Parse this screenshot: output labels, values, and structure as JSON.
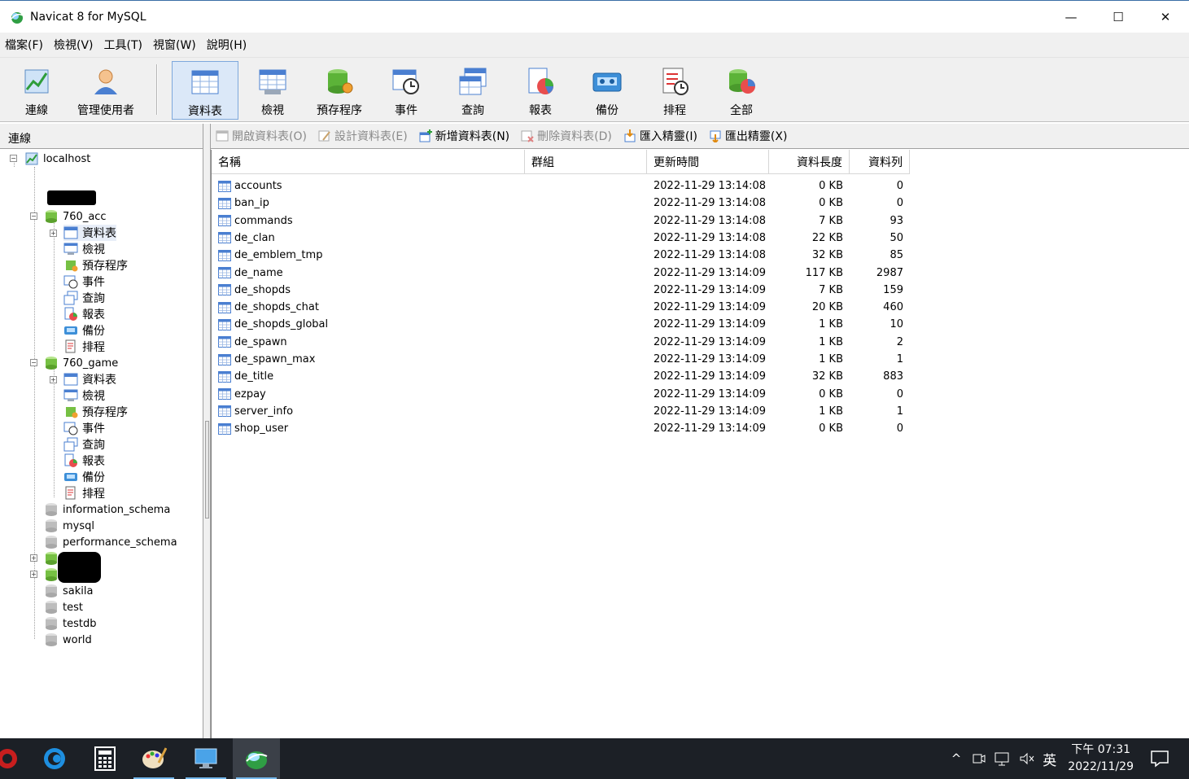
{
  "window": {
    "title": "Navicat 8 for MySQL",
    "minimize": "—",
    "maximize": "☐",
    "close": "✕"
  },
  "menu": [
    "檔案(F)",
    "檢視(V)",
    "工具(T)",
    "視窗(W)",
    "說明(H)"
  ],
  "toolbar": {
    "buttons": [
      {
        "label": "連線",
        "icon": "connection-icon"
      },
      {
        "label": "管理使用者",
        "icon": "user-manager-icon"
      },
      {
        "label": "資料表",
        "icon": "table-icon",
        "active": true
      },
      {
        "label": "檢視",
        "icon": "view-icon"
      },
      {
        "label": "預存程序",
        "icon": "procedure-icon"
      },
      {
        "label": "事件",
        "icon": "event-icon"
      },
      {
        "label": "查詢",
        "icon": "query-icon"
      },
      {
        "label": "報表",
        "icon": "report-icon"
      },
      {
        "label": "備份",
        "icon": "backup-icon"
      },
      {
        "label": "排程",
        "icon": "schedule-icon"
      },
      {
        "label": "全部",
        "icon": "all-icon"
      }
    ]
  },
  "left_panel": {
    "header": "連線",
    "tree": {
      "root": "localhost",
      "db1": "760_acc",
      "db2": "760_game",
      "child_labels": [
        "資料表",
        "檢視",
        "預存程序",
        "事件",
        "查詢",
        "報表",
        "備份",
        "排程"
      ],
      "other_dbs_top": [
        "information_schema",
        "mysql",
        "performance_schema"
      ],
      "other_dbs_bottom": [
        "sakila",
        "test",
        "testdb",
        "world"
      ]
    }
  },
  "object_toolbar": [
    {
      "label": "開啟資料表(O)",
      "enabled": false
    },
    {
      "label": "設計資料表(E)",
      "enabled": false
    },
    {
      "label": "新增資料表(N)",
      "enabled": true
    },
    {
      "label": "刪除資料表(D)",
      "enabled": false
    },
    {
      "label": "匯入精靈(I)",
      "enabled": true
    },
    {
      "label": "匯出精靈(X)",
      "enabled": true
    }
  ],
  "table": {
    "columns": [
      "名稱",
      "群組",
      "更新時間",
      "資料長度",
      "資料列"
    ],
    "rows": [
      {
        "name": "accounts",
        "group": "",
        "updated": "2022-11-29 13:14:08",
        "size": "0 KB",
        "rows": "0"
      },
      {
        "name": "ban_ip",
        "group": "",
        "updated": "2022-11-29 13:14:08",
        "size": "0 KB",
        "rows": "0"
      },
      {
        "name": "commands",
        "group": "",
        "updated": "2022-11-29 13:14:08",
        "size": "7 KB",
        "rows": "93"
      },
      {
        "name": "de_clan",
        "group": "",
        "updated": "2022-11-29 13:14:08",
        "size": "22 KB",
        "rows": "50"
      },
      {
        "name": "de_emblem_tmp",
        "group": "",
        "updated": "2022-11-29 13:14:08",
        "size": "32 KB",
        "rows": "85"
      },
      {
        "name": "de_name",
        "group": "",
        "updated": "2022-11-29 13:14:09",
        "size": "117 KB",
        "rows": "2987"
      },
      {
        "name": "de_shopds",
        "group": "",
        "updated": "2022-11-29 13:14:09",
        "size": "7 KB",
        "rows": "159"
      },
      {
        "name": "de_shopds_chat",
        "group": "",
        "updated": "2022-11-29 13:14:09",
        "size": "20 KB",
        "rows": "460"
      },
      {
        "name": "de_shopds_global",
        "group": "",
        "updated": "2022-11-29 13:14:09",
        "size": "1 KB",
        "rows": "10"
      },
      {
        "name": "de_spawn",
        "group": "",
        "updated": "2022-11-29 13:14:09",
        "size": "1 KB",
        "rows": "2"
      },
      {
        "name": "de_spawn_max",
        "group": "",
        "updated": "2022-11-29 13:14:09",
        "size": "1 KB",
        "rows": "1"
      },
      {
        "name": "de_title",
        "group": "",
        "updated": "2022-11-29 13:14:09",
        "size": "32 KB",
        "rows": "883"
      },
      {
        "name": "ezpay",
        "group": "",
        "updated": "2022-11-29 13:14:09",
        "size": "0 KB",
        "rows": "0"
      },
      {
        "name": "server_info",
        "group": "",
        "updated": "2022-11-29 13:14:09",
        "size": "1 KB",
        "rows": "1"
      },
      {
        "name": "shop_user",
        "group": "",
        "updated": "2022-11-29 13:14:09",
        "size": "0 KB",
        "rows": "0"
      }
    ]
  },
  "taskbar": {
    "tray": {
      "up": "^",
      "ime": "英",
      "time": "下午 07:31",
      "date": "2022/11/29"
    }
  }
}
